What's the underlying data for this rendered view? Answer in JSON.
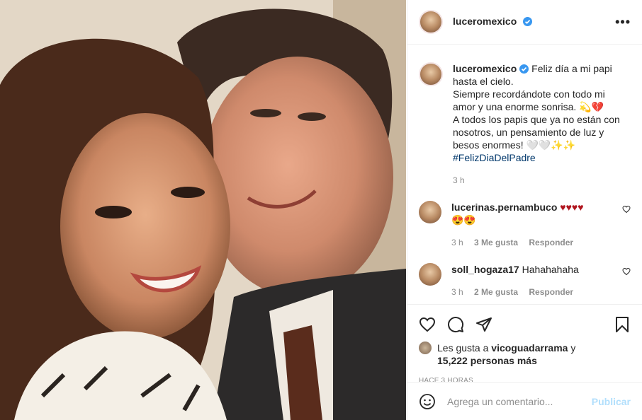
{
  "post": {
    "username": "luceromexico",
    "more_label": "•••"
  },
  "caption": {
    "username": "luceromexico",
    "lines": [
      "Feliz día a mi papi",
      "hasta el cielo.",
      "Siempre recordándote con todo mi",
      "amor y una enorme sonrisa. 💫💔",
      "A todos los papis que ya no están con",
      "nosotros, un pensamiento de luz y",
      "besos enormes! 🤍🤍✨✨"
    ],
    "hashtag": "#FelizDiaDelPadre",
    "time": "3 h"
  },
  "comments": [
    {
      "username": "lucerinas.pernambuco",
      "text": "♥♥♥♥",
      "text2": "😍😍",
      "time": "3 h",
      "likes": "3 Me gusta",
      "reply": "Responder"
    },
    {
      "username": "soll_hogaza17",
      "text": "Hahahahaha",
      "text2": "",
      "time": "3 h",
      "likes": "2 Me gusta",
      "reply": "Responder"
    }
  ],
  "likes": {
    "prefix": "Les gusta a",
    "user": "vicoguadarrama",
    "suffix": "y",
    "count": "15,222 personas más"
  },
  "timestamp": "HACE 3 HORAS",
  "add_comment": {
    "placeholder": "Agrega un comentario...",
    "publish": "Publicar"
  },
  "colors": {
    "verified": "#3897f0",
    "link": "#00376b",
    "muted": "#8e8e8e",
    "publish": "#b2dffc"
  }
}
